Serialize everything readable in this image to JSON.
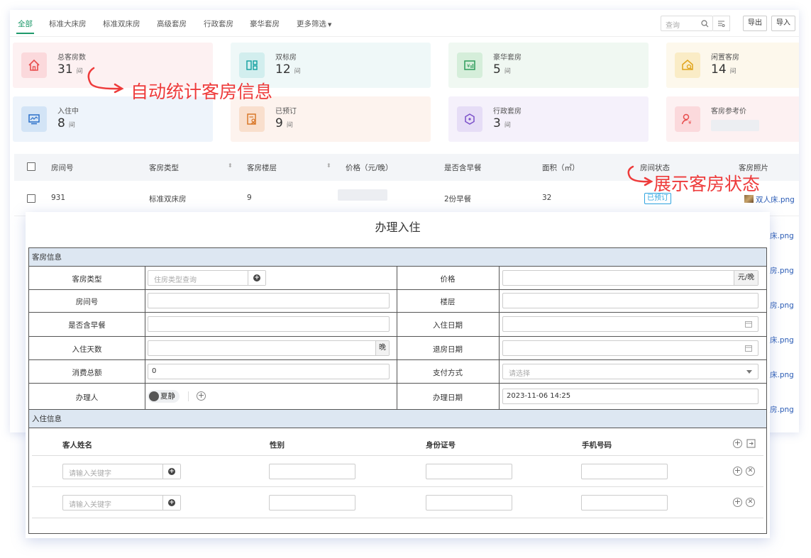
{
  "tabs": [
    {
      "label": "全部",
      "active": true
    },
    {
      "label": "标准大床房"
    },
    {
      "label": "标准双床房"
    },
    {
      "label": "高级套房"
    },
    {
      "label": "行政套房"
    },
    {
      "label": "豪华套房"
    },
    {
      "label": "更多筛选"
    }
  ],
  "toolbar": {
    "search_placeholder": "查询",
    "export_label": "导出",
    "import_label": "导入"
  },
  "stats": [
    {
      "label": "总客房数",
      "value": "31",
      "unit": "间",
      "icon": "home-icon",
      "color": "#e84d4d"
    },
    {
      "label": "双标房",
      "value": "12",
      "unit": "间",
      "icon": "twin-room-icon",
      "color": "#1aa3a3"
    },
    {
      "label": "豪华套房",
      "value": "5",
      "unit": "间",
      "icon": "luxury-price-icon",
      "color": "#2d9c5a"
    },
    {
      "label": "闲置客房",
      "value": "14",
      "unit": "间",
      "icon": "idle-room-icon",
      "color": "#e0a41a"
    },
    {
      "label": "入住中",
      "value": "8",
      "unit": "间",
      "icon": "checkin-monitor-icon",
      "color": "#2a6fc9"
    },
    {
      "label": "已预订",
      "value": "9",
      "unit": "间",
      "icon": "reserved-doc-icon",
      "color": "#d9782a"
    },
    {
      "label": "行政套房",
      "value": "3",
      "unit": "间",
      "icon": "hexagon-icon",
      "color": "#7a4fc9"
    },
    {
      "label": "客房参考价",
      "value": "",
      "unit": "",
      "icon": "price-person-icon",
      "color": "#e84d4d"
    }
  ],
  "annotations": {
    "stats_note": "自动统计客房信息",
    "status_note": "展示客房状态"
  },
  "table": {
    "headers": [
      "房间号",
      "客房类型",
      "客房楼层",
      "价格（元/晚）",
      "是否含早餐",
      "面积（㎡）",
      "房间状态",
      "客房照片"
    ],
    "row": {
      "room": "931",
      "type": "标准双床房",
      "floor": "9",
      "breakfast": "2份早餐",
      "area": "32",
      "status": "已预订",
      "photo": "双人床.png"
    },
    "partial_photos": [
      "床.png",
      "房.png",
      "房.png",
      "床.png",
      "床.png",
      "房.png"
    ]
  },
  "modal": {
    "title": "办理入住",
    "section_room": "客房信息",
    "section_guest": "入住信息",
    "fields": {
      "room_type": {
        "label": "客房类型",
        "placeholder": "住房类型查询"
      },
      "price": {
        "label": "价格",
        "suffix": "元/晚"
      },
      "room_no": {
        "label": "房间号"
      },
      "floor": {
        "label": "楼层"
      },
      "breakfast": {
        "label": "是否含早餐"
      },
      "checkin_date": {
        "label": "入住日期"
      },
      "days": {
        "label": "入住天数",
        "suffix": "晚"
      },
      "checkout_date": {
        "label": "退房日期"
      },
      "total": {
        "label": "消费总额",
        "value": "0"
      },
      "payment": {
        "label": "支付方式",
        "placeholder": "请选择"
      },
      "handler": {
        "label": "办理人",
        "person": "夏静"
      },
      "handle_date": {
        "label": "办理日期",
        "value": "2023-11-06 14:25"
      }
    },
    "guest_headers": {
      "name": "客人姓名",
      "gender": "性别",
      "id": "身份证号",
      "phone": "手机号码"
    },
    "guest_placeholder": "请输入关键字"
  }
}
